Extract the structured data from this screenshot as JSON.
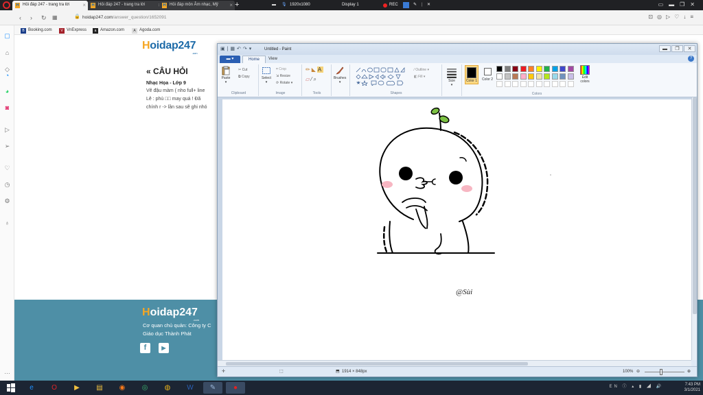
{
  "browser": {
    "tabs": [
      {
        "label": "Hỏi đáp 247 - trang tra lời",
        "active": true
      },
      {
        "label": "Hỏi đáp 247 - trang tra lời",
        "active": false
      },
      {
        "label": "Hỏi đáp môn Âm nhạc, Mỹ",
        "active": false
      }
    ],
    "tab_favicon": "H",
    "new_tab": "+",
    "recorder": {
      "resolution": "1920x1080",
      "display": "Display 1",
      "rec": "REC"
    },
    "url": {
      "domain": "hoidap247.com",
      "path": "/answer_question/1652091"
    },
    "bookmarks": [
      {
        "label": "Booking.com",
        "icon": "B",
        "color": "#1b3f8a"
      },
      {
        "label": "VnExpress",
        "icon": "V",
        "color": "#a4212a"
      },
      {
        "label": "Amazon.com",
        "icon": "a",
        "color": "#222222"
      },
      {
        "label": "Agoda.com",
        "icon": "A",
        "color": "#e8e8e8"
      }
    ]
  },
  "page": {
    "logo": {
      "first": "H",
      "rest": "oidap247",
      "suffix": ".com"
    },
    "question_title": "« CÂU HỎI",
    "category": "Nhạc Họa - Lớp 9",
    "lines": [
      "Vẽ đậu màm ( nho full+ line",
      "Lê : phù □□ may quá ! Đã",
      "chính r -> lần sau sẽ ghi nhó"
    ],
    "footer": {
      "logo": {
        "first": "H",
        "rest": "oidap247",
        "suffix": ".com"
      },
      "line1": "Cơ quan chủ quản: Công ty C",
      "line2": "Giáo dục Thành Phát",
      "social": [
        "f",
        "▶"
      ]
    }
  },
  "paint": {
    "title": "Untitled - Paint",
    "file_button": "▬ ▾",
    "tabs": [
      "Home",
      "View"
    ],
    "groups": {
      "clipboard": {
        "label": "Clipboard",
        "paste": "Paste",
        "cut": "Cut",
        "copy": "Copy"
      },
      "image": {
        "label": "Image",
        "select": "Select",
        "crop": "Crop",
        "resize": "Resize",
        "rotate": "Rotate"
      },
      "tools": {
        "label": "Tools"
      },
      "brushes": {
        "label": "Brushes"
      },
      "shapes": {
        "label": "Shapes",
        "outline": "Outline",
        "fill": "Fill"
      },
      "size": {
        "label": "Size"
      },
      "color1": {
        "label": "Color 1"
      },
      "color2": {
        "label": "Color 2"
      },
      "colors": {
        "label": "Colors"
      },
      "edit_colors": {
        "label": "Edit colors"
      }
    },
    "palette_row1": [
      "#000000",
      "#7f7f7f",
      "#880015",
      "#ed1c24",
      "#ff7f27",
      "#fff200",
      "#22b14c",
      "#00a2e8",
      "#3f48cc",
      "#a349a4"
    ],
    "palette_row2": [
      "#ffffff",
      "#c3c3c3",
      "#b97a57",
      "#ffaec9",
      "#ffc90e",
      "#efe4b0",
      "#b5e61d",
      "#99d9ea",
      "#7092be",
      "#c8bfe7"
    ],
    "canvas_signature": "@Sùi",
    "status": {
      "size": "1914 × 848px",
      "zoom": "100%"
    }
  },
  "taskbar": {
    "apps": [
      {
        "name": "ie",
        "glyph": "e",
        "color": "#1e90ff"
      },
      {
        "name": "opera",
        "glyph": "O",
        "color": "#e0262a"
      },
      {
        "name": "media",
        "glyph": "▶",
        "color": "#f0c040"
      },
      {
        "name": "explorer",
        "glyph": "▤",
        "color": "#f0c040"
      },
      {
        "name": "firefox",
        "glyph": "◉",
        "color": "#ff7a1a"
      },
      {
        "name": "green-app",
        "glyph": "◎",
        "color": "#3cb371"
      },
      {
        "name": "chrome",
        "glyph": "◍",
        "color": "#e8b21b"
      },
      {
        "name": "word",
        "glyph": "W",
        "color": "#2b5fb3"
      },
      {
        "name": "paint",
        "glyph": "✎",
        "color": "#9db7d8"
      },
      {
        "name": "recorder",
        "glyph": "●",
        "color": "#e22222"
      }
    ],
    "lang": "EN",
    "time": "7:43 PM",
    "date": "3/1/2021"
  }
}
